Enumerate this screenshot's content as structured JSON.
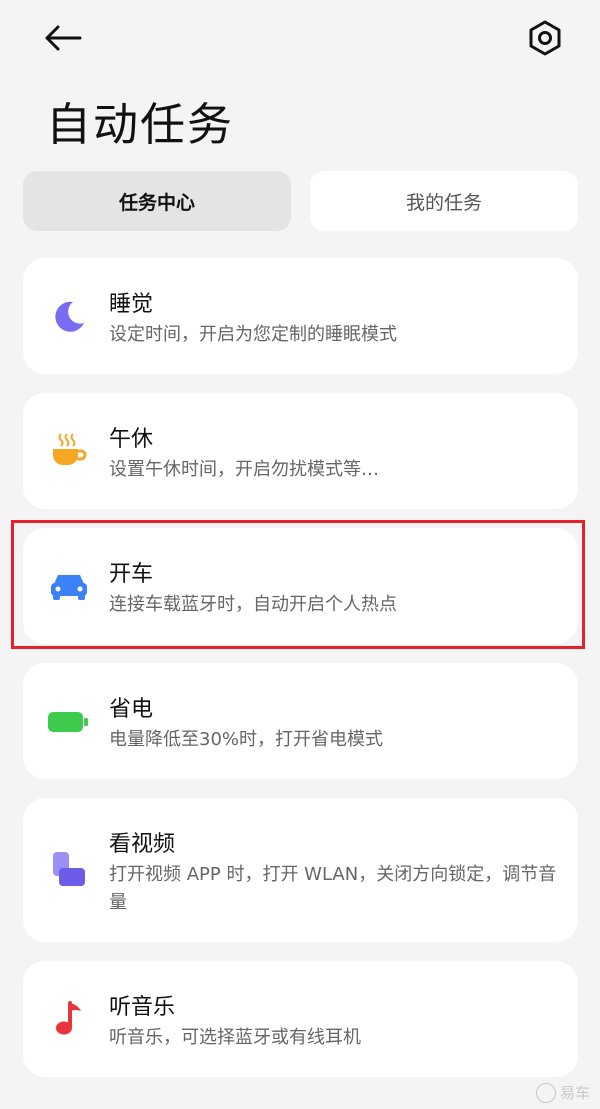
{
  "header": {
    "back_icon": "arrow-left-icon",
    "settings_icon": "gear-hexagon-icon",
    "title": "自动任务"
  },
  "tabs": [
    {
      "label": "任务中心",
      "active": true
    },
    {
      "label": "我的任务",
      "active": false
    }
  ],
  "tasks": [
    {
      "title": "睡觉",
      "desc": "设定时间，开启为您定制的睡眠模式",
      "icon": "moon-icon",
      "color": "#7a6cf0"
    },
    {
      "title": "午休",
      "desc": "设置午休时间，开启勿扰模式等…",
      "icon": "coffee-cup-icon",
      "color": "#f5a623"
    },
    {
      "title": "开车",
      "desc": "连接车载蓝牙时，自动开启个人热点",
      "icon": "car-icon",
      "color": "#3b82f6"
    },
    {
      "title": "省电",
      "desc": "电量降低至30%时，打开省电模式",
      "icon": "battery-icon",
      "color": "#3ccb4c"
    },
    {
      "title": "看视频",
      "desc": "打开视频 APP 时，打开 WLAN，关闭方向锁定，调节音量",
      "icon": "video-icon",
      "color": "#7a6cf0"
    },
    {
      "title": "听音乐",
      "desc": "听音乐，可选择蓝牙或有线耳机",
      "icon": "music-note-icon",
      "color": "#e8343c"
    }
  ],
  "watermark": "易车"
}
